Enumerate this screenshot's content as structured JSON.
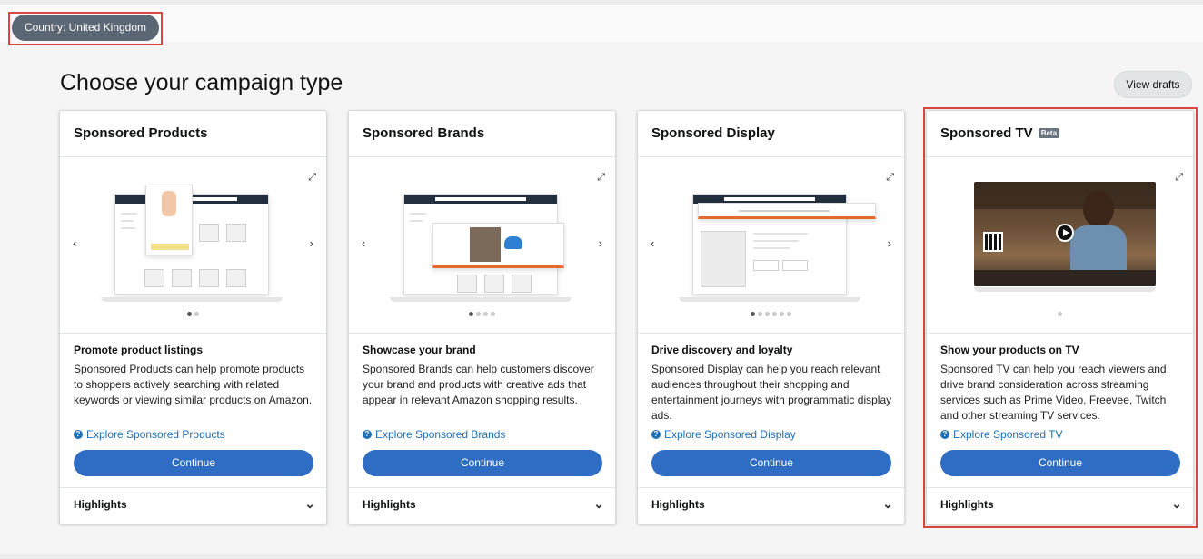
{
  "country_pill": "Country: United Kingdom",
  "heading": "Choose your campaign type",
  "view_drafts": "View drafts",
  "cards": [
    {
      "title": "Sponsored Products",
      "body_title": "Promote product listings",
      "description": "Sponsored Products can help promote products to shoppers actively searching with related keywords or viewing similar products on Amazon.",
      "explore": "Explore Sponsored Products",
      "continue": "Continue",
      "highlights": "Highlights",
      "slide_count": 2
    },
    {
      "title": "Sponsored Brands",
      "body_title": "Showcase your brand",
      "description": "Sponsored Brands can help customers discover your brand and products with creative ads that appear in relevant Amazon shopping results.",
      "explore": "Explore Sponsored Brands",
      "continue": "Continue",
      "highlights": "Highlights",
      "slide_count": 4
    },
    {
      "title": "Sponsored Display",
      "body_title": "Drive discovery and loyalty",
      "description": "Sponsored Display can help you reach relevant audiences throughout their shopping and entertainment journeys with programmatic display ads.",
      "explore": "Explore Sponsored Display",
      "continue": "Continue",
      "highlights": "Highlights",
      "slide_count": 6
    },
    {
      "title": "Sponsored TV",
      "badge": "Beta",
      "body_title": "Show your products on TV",
      "description": "Sponsored TV can help you reach viewers and drive brand consideration across streaming services such as Prime Video, Freevee, Twitch and other streaming TV services.",
      "explore": "Explore Sponsored TV",
      "continue": "Continue",
      "highlights": "Highlights",
      "slide_count": 1
    }
  ],
  "colors": {
    "accent_blue": "#2f6dc5",
    "link_blue": "#1f6fb5",
    "pill_gray": "#5b6774",
    "highlight_red": "#d9473e"
  }
}
